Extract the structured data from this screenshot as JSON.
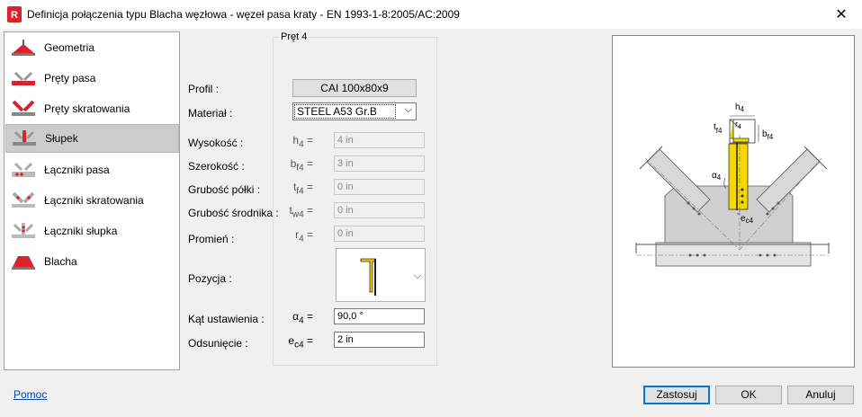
{
  "window": {
    "title": "Definicja połączenia typu Blacha węzłowa - węzeł pasa kraty - EN 1993-1-8:2005/AC:2009",
    "app_icon_letter": "R"
  },
  "sidebar": {
    "items": [
      {
        "label": "Geometria",
        "icon": "geometry-icon"
      },
      {
        "label": "Pręty pasa",
        "icon": "chord-bars-icon"
      },
      {
        "label": "Pręty skratowania",
        "icon": "bracing-bars-icon"
      },
      {
        "label": "Słupek",
        "icon": "post-icon",
        "selected": true
      },
      {
        "label": "Łączniki pasa",
        "icon": "chord-connectors-icon"
      },
      {
        "label": "Łączniki skratowania",
        "icon": "bracing-connectors-icon"
      },
      {
        "label": "Łączniki słupka",
        "icon": "post-connectors-icon"
      },
      {
        "label": "Blacha",
        "icon": "plate-icon"
      }
    ]
  },
  "group": {
    "title": "Pręt 4"
  },
  "form": {
    "profile": {
      "label": "Profil :",
      "value": "CAI 100x80x9"
    },
    "material": {
      "label": "Materiał :",
      "value": "STEEL A53 Gr.B"
    },
    "height": {
      "label": "Wysokość :",
      "sym": "h",
      "sub": "4",
      "eq": "=",
      "value": "4 in"
    },
    "width": {
      "label": "Szerokość :",
      "sym": "b",
      "sub": "f4",
      "eq": "=",
      "value": "3 in"
    },
    "flange": {
      "label": "Grubość półki :",
      "sym": "t",
      "sub": "f4",
      "eq": "=",
      "value": "0 in"
    },
    "web": {
      "label": "Grubość środnika :",
      "sym": "t",
      "sub": "w4",
      "eq": "=",
      "value": "0 in"
    },
    "radius": {
      "label": "Promień :",
      "sym": "r",
      "sub": "4",
      "eq": "=",
      "value": "0 in"
    },
    "position": {
      "label": "Pozycja :"
    },
    "angle": {
      "label": "Kąt ustawienia :",
      "sym": "α",
      "sub": "4",
      "eq": "=",
      "value": "90,0 °"
    },
    "offset": {
      "label": "Odsunięcie :",
      "sym": "e",
      "sub": "c4",
      "eq": "=",
      "value": "2 in"
    }
  },
  "preview": {
    "labels": {
      "h4": "h",
      "h4_sub": "4",
      "r4": "r",
      "r4_sub": "4",
      "tf4": "t",
      "tf4_sub": "f4",
      "bf4": "b",
      "bf4_sub": "f4",
      "a4": "α",
      "a4_sub": "4",
      "ec4": "e",
      "ec4_sub": "c4"
    }
  },
  "footer": {
    "help": "Pomoc",
    "apply": "Zastosuj",
    "ok": "OK",
    "cancel": "Anuluj"
  },
  "colors": {
    "accent_red": "#d9232e",
    "highlight_yellow": "#f5d800",
    "focus_blue": "#0078d7"
  }
}
